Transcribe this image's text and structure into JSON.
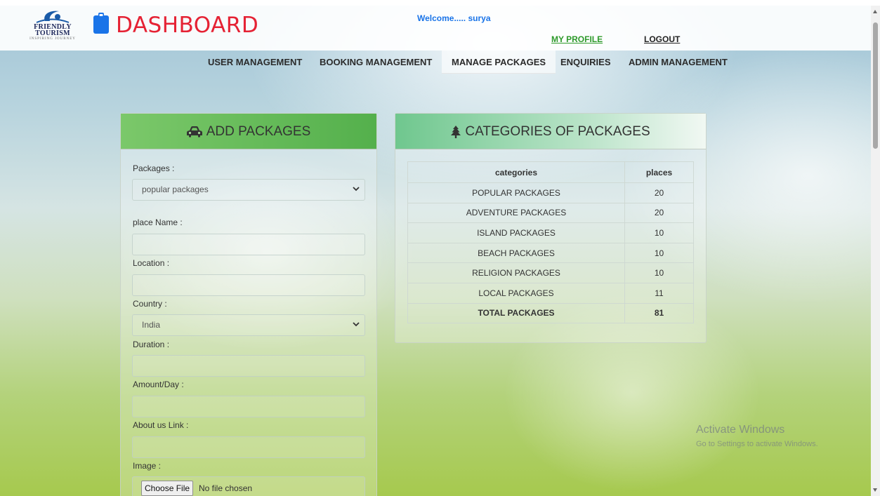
{
  "header": {
    "logo": {
      "line1": "FRIENDLY",
      "line2": "TOURISM",
      "line3": "INSPIRING JOURNEY"
    },
    "title": "DASHBOARD",
    "welcome": "Welcome..... surya",
    "my_profile": "MY PROFILE",
    "logout": "LOGOUT"
  },
  "nav": {
    "items": [
      {
        "label": "USER MANAGEMENT"
      },
      {
        "label": "BOOKING MANAGEMENT"
      },
      {
        "label": "MANAGE PACKAGES",
        "active": true
      },
      {
        "label": "ENQUIRIES"
      },
      {
        "label": "ADMIN MANAGEMENT"
      }
    ]
  },
  "add_packages": {
    "title": "ADD PACKAGES",
    "icon": "car-icon",
    "fields": {
      "packages_label": "Packages :",
      "packages_value": "popular packages",
      "place_name_label": "place Name :",
      "place_name_value": "",
      "location_label": "Location :",
      "location_value": "",
      "country_label": "Country :",
      "country_value": "India",
      "duration_label": "Duration :",
      "duration_value": "",
      "amount_label": "Amount/Day :",
      "amount_value": "",
      "about_label": "About us Link :",
      "about_value": "",
      "image_label": "Image :",
      "file_button": "Choose File",
      "file_status": "No file chosen"
    }
  },
  "categories": {
    "title": "CATEGORIES OF PACKAGES",
    "icon": "tree-icon",
    "columns": [
      "categories",
      "places"
    ],
    "rows": [
      {
        "name": "POPULAR PACKAGES",
        "places": "20"
      },
      {
        "name": "ADVENTURE PACKAGES",
        "places": "20"
      },
      {
        "name": "ISLAND PACKAGES",
        "places": "10"
      },
      {
        "name": "BEACH PACKAGES",
        "places": "10"
      },
      {
        "name": "RELIGION PACKAGES",
        "places": "10"
      },
      {
        "name": "LOCAL PACKAGES",
        "places": "11"
      }
    ],
    "total": {
      "name": "TOTAL PACKAGES",
      "places": "81"
    }
  },
  "watermark": {
    "title": "Activate Windows",
    "subtitle": "Go to Settings to activate Windows."
  },
  "colors": {
    "title_red": "#e52234",
    "welcome_blue": "#1a74e8",
    "profile_green": "#2e9a2b",
    "add_header_green": "#5cb85c"
  }
}
